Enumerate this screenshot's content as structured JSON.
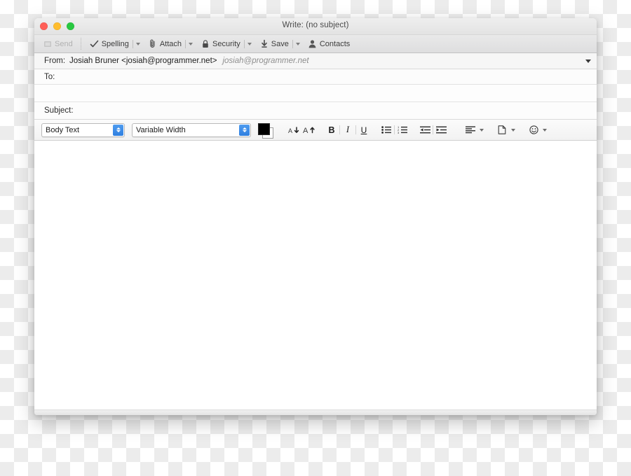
{
  "window": {
    "title": "Write: (no subject)",
    "traffic_lights": [
      {
        "name": "close",
        "color": "#ff5f57"
      },
      {
        "name": "minimize",
        "color": "#ffbd2e"
      },
      {
        "name": "zoom",
        "color": "#28c840"
      }
    ]
  },
  "toolbar": {
    "send": {
      "label": "Send",
      "icon": "send-icon",
      "enabled": false
    },
    "spelling": {
      "label": "Spelling",
      "icon": "checkmark-icon"
    },
    "attach": {
      "label": "Attach",
      "icon": "paperclip-icon"
    },
    "security": {
      "label": "Security",
      "icon": "lock-icon"
    },
    "save": {
      "label": "Save",
      "icon": "download-arrow-icon"
    },
    "contacts": {
      "label": "Contacts",
      "icon": "person-icon"
    }
  },
  "fields": {
    "from_label": "From:",
    "from_value": "Josiah Bruner <josiah@programmer.net>",
    "from_alias": "josiah@programmer.net",
    "to_label": "To:",
    "to_value": "",
    "subject_label": "Subject:",
    "subject_value": ""
  },
  "formatbar": {
    "paragraph_style": "Body Text",
    "font_family": "Variable Width",
    "foreground_color": "#000000",
    "background_color": "#ffffff",
    "buttons": [
      {
        "name": "decrease-font-size-icon",
        "label": "A"
      },
      {
        "name": "increase-font-size-icon",
        "label": "A"
      },
      {
        "name": "bold-button",
        "label": "B"
      },
      {
        "name": "italic-button",
        "label": "I"
      },
      {
        "name": "underline-button",
        "label": "U"
      },
      {
        "name": "bullet-list-button",
        "label": ""
      },
      {
        "name": "numbered-list-button",
        "label": ""
      },
      {
        "name": "outdent-button",
        "label": ""
      },
      {
        "name": "indent-button",
        "label": ""
      },
      {
        "name": "align-button",
        "label": ""
      },
      {
        "name": "insert-button",
        "label": ""
      },
      {
        "name": "emoticon-button",
        "label": ""
      }
    ]
  },
  "compose": {
    "body_text": ""
  }
}
